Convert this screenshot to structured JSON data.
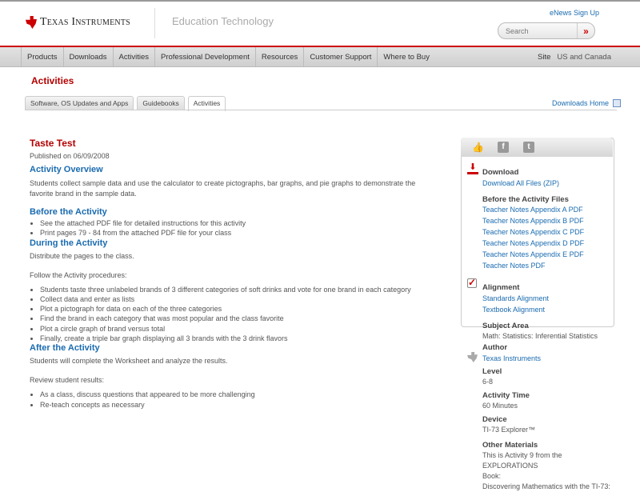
{
  "header": {
    "brand": "Texas Instruments",
    "section": "Education Technology",
    "enews": "eNews Sign Up",
    "search_placeholder": "Search",
    "search_go": "»"
  },
  "nav": {
    "items": [
      "Products",
      "Downloads",
      "Activities",
      "Professional Development",
      "Resources",
      "Customer Support",
      "Where to Buy"
    ],
    "site_label": "Site",
    "site_value": "US and Canada"
  },
  "page_title": "Activities",
  "tabs": [
    "Software, OS Updates and Apps",
    "Guidebooks",
    "Activities"
  ],
  "downloads_home": "Downloads Home",
  "main": {
    "title": "Taste Test",
    "published": "Published on 06/09/2008",
    "overview_h": "Activity Overview",
    "overview": "Students collect sample data and use the calculator to create pictographs, bar graphs, and pie graphs to demonstrate the favorite brand in the sample data.",
    "before_h": "Before the Activity",
    "before": [
      "See the attached PDF file for detailed instructions for this activity",
      "Print pages 79 - 84 from the attached PDF file for your class"
    ],
    "during_h": "During the Activity",
    "during_p1": "Distribute the pages to the class.",
    "during_p2": "Follow the Activity procedures:",
    "during": [
      "Students taste three unlabeled brands of 3 different categories of soft drinks and vote for one brand in each category",
      "Collect data and enter as lists",
      "Plot a pictograph for data on each of the three categories",
      "Find the brand in each category that was most popular and the class favorite",
      "Plot a circle graph of brand versus total",
      "Finally, create a triple bar graph displaying all 3 brands with the 3 drink flavors"
    ],
    "after_h": "After the Activity",
    "after_p1": "Students will complete the Worksheet and analyze the results.",
    "after_p2": "Review student results:",
    "after": [
      "As a class, discuss questions that appeared to be more challenging",
      "Re-teach concepts as necessary"
    ]
  },
  "panel": {
    "download_h": "Download",
    "download_all": "Download All Files (ZIP)",
    "before_files_h": "Before the Activity Files",
    "files": [
      "Teacher Notes Appendix A PDF",
      "Teacher Notes Appendix B PDF",
      "Teacher Notes Appendix C PDF",
      "Teacher Notes Appendix D PDF",
      "Teacher Notes Appendix E PDF",
      "Teacher Notes PDF"
    ],
    "alignment_h": "Alignment",
    "alignment": [
      "Standards Alignment",
      "Textbook Alignment"
    ],
    "subject_h": "Subject Area",
    "subject": "Math: Statistics: Inferential Statistics",
    "author_h": "Author",
    "author": "Texas Instruments",
    "level_h": "Level",
    "level": "6-8",
    "time_h": "Activity Time",
    "time": "60 Minutes",
    "device_h": "Device",
    "device": "TI-73 Explorer™",
    "other_h": "Other Materials",
    "other": [
      "This is Activity 9 from the EXPLORATIONS",
      "Book:",
      "Discovering Mathematics with the TI-73:"
    ]
  }
}
